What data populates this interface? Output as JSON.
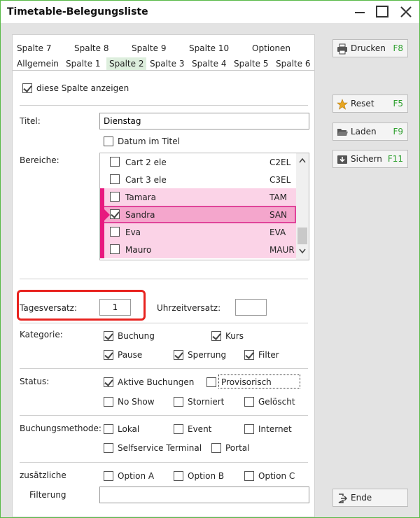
{
  "window": {
    "title": "Timetable-Belegungsliste"
  },
  "tabs_row1": [
    "Spalte 7",
    "Spalte 8",
    "Spalte 9",
    "Spalte 10",
    "Optionen"
  ],
  "tabs_row2": [
    "Allgemein",
    "Spalte 1",
    "Spalte 2",
    "Spalte 3",
    "Spalte 4",
    "Spalte 5",
    "Spalte 6"
  ],
  "active_tab": "Spalte 2",
  "show_column": {
    "label": "diese Spalte anzeigen",
    "checked": true
  },
  "titel": {
    "label": "Titel:",
    "value": "Dienstag"
  },
  "datum_im_titel": {
    "label": "Datum im Titel",
    "checked": false
  },
  "bereiche": {
    "label": "Bereiche:",
    "items": [
      {
        "name": "Cart 2 ele",
        "code": "C2EL",
        "checked": false,
        "style": "normal"
      },
      {
        "name": "Cart 3 ele",
        "code": "C3EL",
        "checked": false,
        "style": "normal"
      },
      {
        "name": "Tamara",
        "code": "TAM",
        "checked": false,
        "style": "pink"
      },
      {
        "name": "Sandra",
        "code": "SAN",
        "checked": true,
        "style": "selected"
      },
      {
        "name": "Eva",
        "code": "EVA",
        "checked": false,
        "style": "pink"
      },
      {
        "name": "Mauro",
        "code": "MAUR",
        "checked": false,
        "style": "pink"
      }
    ]
  },
  "tagesversatz": {
    "label": "Tagesversatz:",
    "value": "1"
  },
  "uhrzeitversatz": {
    "label": "Uhrzeitversatz:",
    "value": ""
  },
  "kategorie": {
    "label": "Kategorie:",
    "buchung": {
      "label": "Buchung",
      "checked": true
    },
    "kurs": {
      "label": "Kurs",
      "checked": true
    },
    "pause": {
      "label": "Pause",
      "checked": true
    },
    "sperrung": {
      "label": "Sperrung",
      "checked": true
    },
    "filter": {
      "label": "Filter",
      "checked": true
    }
  },
  "status": {
    "label": "Status:",
    "aktive": {
      "label": "Aktive Buchungen",
      "checked": true
    },
    "provisorisch": {
      "label": "Provisorisch",
      "checked": false
    },
    "noshow": {
      "label": "No Show",
      "checked": false
    },
    "storniert": {
      "label": "Storniert",
      "checked": false
    },
    "geloescht": {
      "label": "Gelöscht",
      "checked": false
    }
  },
  "buchungsmethode": {
    "label": "Buchungsmethode:",
    "lokal": {
      "label": "Lokal",
      "checked": false
    },
    "event": {
      "label": "Event",
      "checked": false
    },
    "internet": {
      "label": "Internet",
      "checked": false
    },
    "selfservice": {
      "label": "Selfservice Terminal",
      "checked": false
    },
    "portal": {
      "label": "Portal",
      "checked": false
    }
  },
  "zusaetzliche": {
    "label1": "zusätzliche",
    "label2": "Filterung",
    "option_a": {
      "label": "Option A",
      "checked": false
    },
    "option_b": {
      "label": "Option B",
      "checked": false
    },
    "option_c": {
      "label": "Option C",
      "checked": false
    },
    "filter_value": ""
  },
  "side_buttons": {
    "drucken": {
      "label": "Drucken",
      "key": "F8",
      "icon": "printer-icon"
    },
    "reset": {
      "label": "Reset",
      "key": "F5",
      "icon": "star-icon"
    },
    "laden": {
      "label": "Laden",
      "key": "F9",
      "icon": "folder-open-icon"
    },
    "sichern": {
      "label": "Sichern",
      "key": "F11",
      "icon": "save-icon"
    },
    "ende": {
      "label": "Ende",
      "icon": "exit-icon"
    }
  },
  "colors": {
    "accent": "#58b947",
    "key": "#2ea02e",
    "pink": "#fbd3e7",
    "pink_bar": "#e8197f",
    "highlight": "#e8231f"
  }
}
